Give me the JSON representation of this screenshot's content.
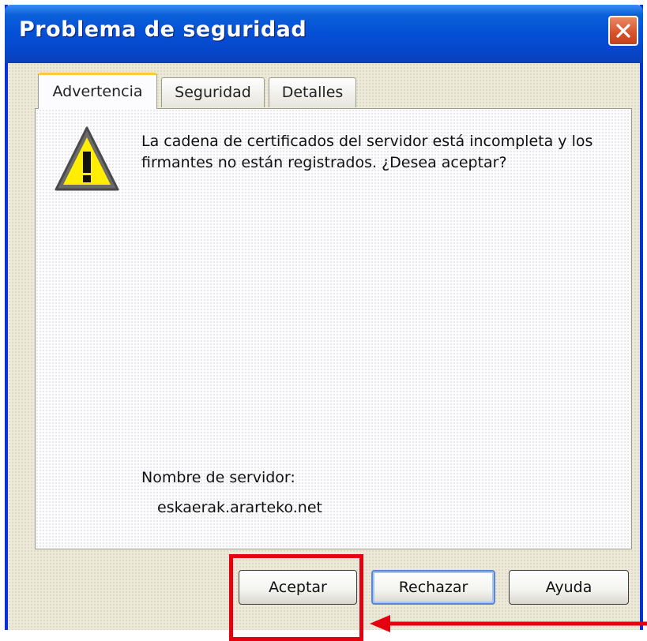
{
  "window": {
    "title": "Problema de seguridad",
    "accent_color": "#0831d9",
    "close_icon": "close-icon"
  },
  "tabs": [
    {
      "label": "Advertencia",
      "active": true
    },
    {
      "label": "Seguridad",
      "active": false
    },
    {
      "label": "Detalles",
      "active": false
    }
  ],
  "content": {
    "icon": "warning-icon",
    "message": "La cadena de certificados del servidor está incompleta y los firmantes no están registrados. ¿Desea aceptar?",
    "server_label": "Nombre de servidor:",
    "server_name": "eskaerak.ararteko.net"
  },
  "buttons": {
    "accept": "Aceptar",
    "reject": "Rechazar",
    "help": "Ayuda"
  },
  "annotation": {
    "color": "#e4000f",
    "target": "Aceptar",
    "arrow_icon": "arrow-left-icon"
  }
}
